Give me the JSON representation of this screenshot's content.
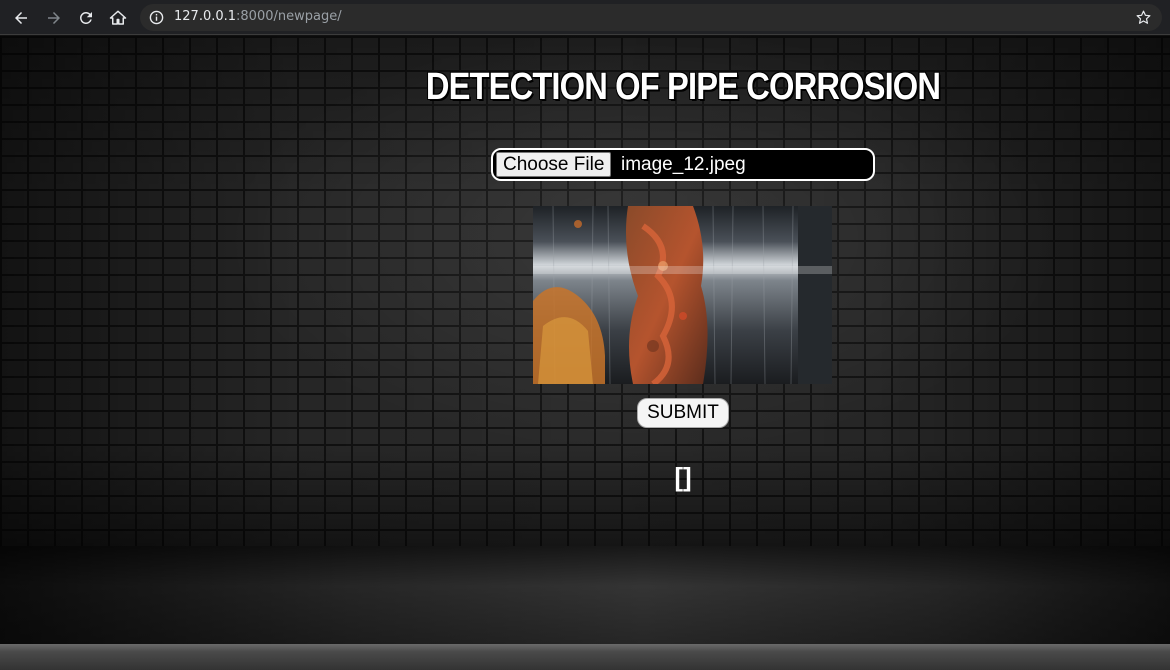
{
  "browser": {
    "url_host": "127.0.0.1",
    "url_rest": ":8000/newpage/",
    "icons": [
      "back-arrow-icon",
      "forward-arrow-icon",
      "reload-icon",
      "home-icon",
      "info-icon",
      "star-icon"
    ]
  },
  "page": {
    "title": "DETECTION OF PIPE CORROSION",
    "file_input": {
      "button_label": "Choose File",
      "file_name": "image_12.jpeg"
    },
    "submit_label": "SUBMIT",
    "result_text": "[]"
  },
  "colors": {
    "text": "#ffffff",
    "chrome_bg": "#202124",
    "omnibox_bg": "#2b2b2b"
  }
}
